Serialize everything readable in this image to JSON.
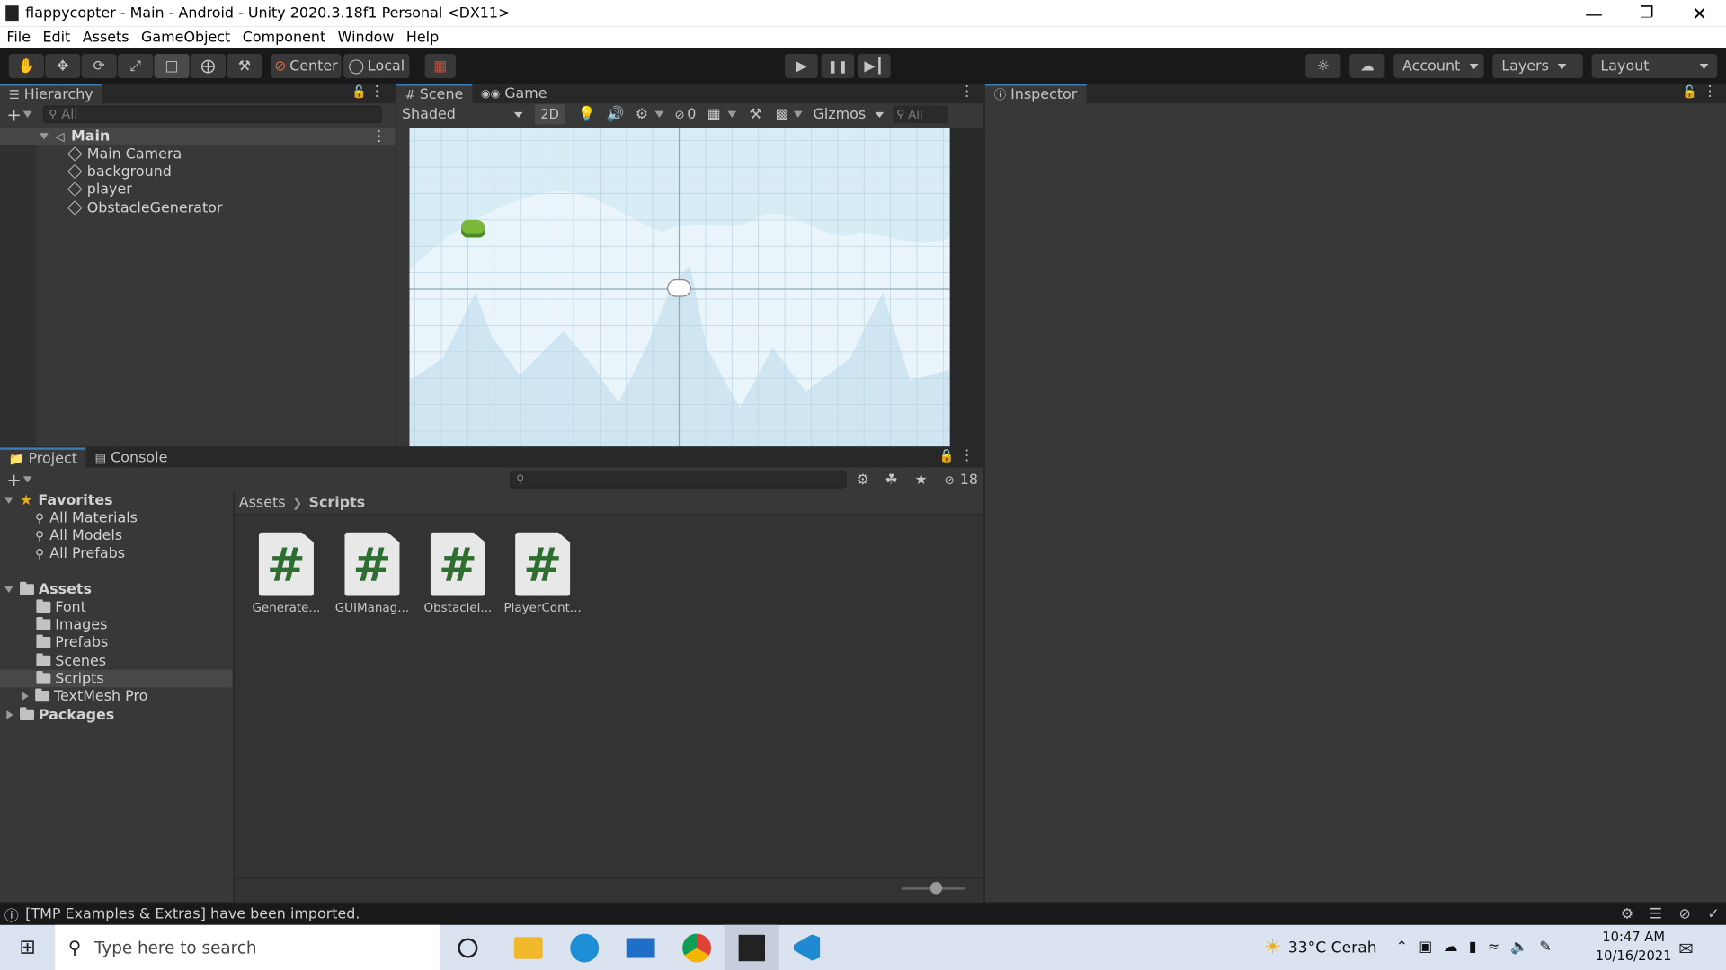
{
  "window": {
    "title": "flappycopter - Main - Android - Unity 2020.3.18f1 Personal <DX11>"
  },
  "menu": [
    "File",
    "Edit",
    "Assets",
    "GameObject",
    "Component",
    "Window",
    "Help"
  ],
  "toolbar": {
    "pivot_label": "Center",
    "space_label": "Local",
    "account_label": "Account",
    "layers_label": "Layers",
    "layout_label": "Layout"
  },
  "hierarchy": {
    "tab": "Hierarchy",
    "search_placeholder": "All",
    "scene": "Main",
    "items": [
      "Main Camera",
      "background",
      "player",
      "ObstacleGenerator"
    ]
  },
  "scene_view": {
    "tabs": [
      "Scene",
      "Game"
    ],
    "shading": "Shaded",
    "mode_2d": "2D",
    "hidden_count": "0",
    "gizmos": "Gizmos",
    "search_placeholder": "All"
  },
  "inspector": {
    "tab": "Inspector"
  },
  "project": {
    "tabs": [
      "Project",
      "Console"
    ],
    "hidden_count": "18",
    "breadcrumb": [
      "Assets",
      "Scripts"
    ],
    "favorites": {
      "label": "Favorites",
      "items": [
        "All Materials",
        "All Models",
        "All Prefabs"
      ]
    },
    "assets": {
      "label": "Assets",
      "items": [
        "Font",
        "Images",
        "Prefabs",
        "Scenes",
        "Scripts",
        "TextMesh Pro"
      ],
      "selected": "Scripts"
    },
    "packages": "Packages",
    "files": [
      "Generate...",
      "GUIManag...",
      "Obstaclel...",
      "PlayerCont..."
    ],
    "file_icon_glyph": "#"
  },
  "status_bar": {
    "message": "[TMP Examples & Extras] have been imported."
  },
  "taskbar": {
    "search_placeholder": "Type here to search",
    "weather": "33°C Cerah",
    "time": "10:47 AM",
    "date": "10/16/2021"
  },
  "colors": {
    "accent": "#2c5d87",
    "toolbar": "#191919",
    "panel": "#383838",
    "scene_sky": "#d8ecf6"
  }
}
